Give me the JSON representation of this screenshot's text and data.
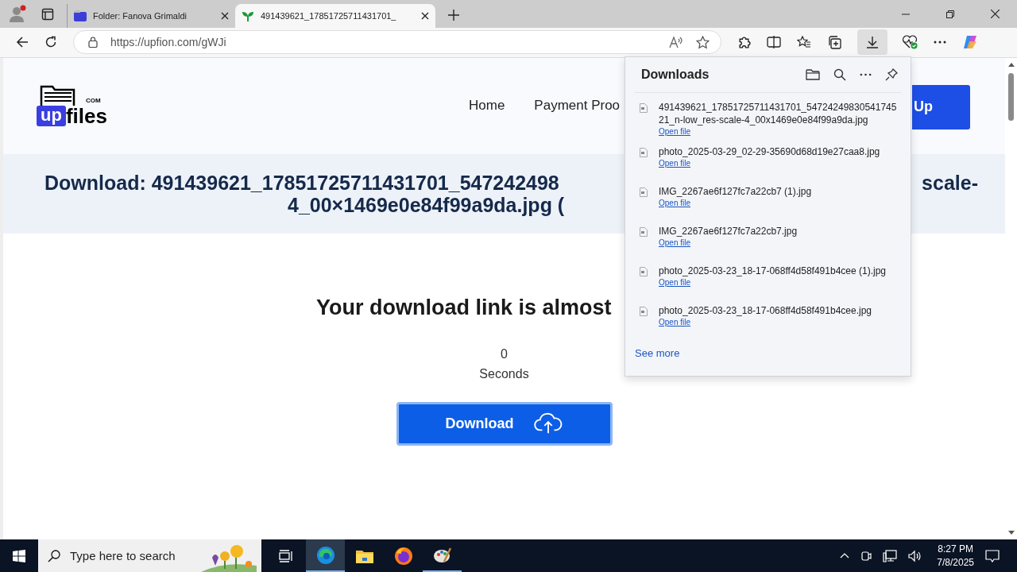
{
  "tabs": [
    {
      "title": "Folder: Fanova Grimaldi",
      "selected": false
    },
    {
      "title": "491439621_17851725711431701_",
      "selected": true
    }
  ],
  "address": "https://upfion.com/gWJi",
  "page": {
    "logo": {
      "mark": "up",
      "word": "files",
      "suffix": "COM"
    },
    "nav": [
      "Home",
      "Payment Proo"
    ],
    "nav_button": "Up",
    "heading": {
      "line1_left": "Download: 491439621_17851725711431701_547242498",
      "line1_right": "scale-",
      "line2": "4_00×1469e0e84f99a9da.jpg ("
    },
    "notice": "Your download link is almost",
    "countdown": "0",
    "countdown_unit": "Seconds",
    "download_button": "Download"
  },
  "downloads": {
    "title": "Downloads",
    "items": [
      {
        "name": "491439621_17851725711431701_5472424983054174521_n-low_res-scale-4_00x1469e0e84f99a9da.jpg",
        "action": "Open file"
      },
      {
        "name": "photo_2025-03-29_02-29-35690d68d19e27caa8.jpg",
        "action": "Open file"
      },
      {
        "name": "IMG_2267ae6f127fc7a22cb7 (1).jpg",
        "action": "Open file"
      },
      {
        "name": "IMG_2267ae6f127fc7a22cb7.jpg",
        "action": "Open file"
      },
      {
        "name": "photo_2025-03-23_18-17-068ff4d58f491b4cee (1).jpg",
        "action": "Open file"
      },
      {
        "name": "photo_2025-03-23_18-17-068ff4d58f491b4cee.jpg",
        "action": "Open file"
      }
    ],
    "see_more": "See more"
  },
  "taskbar": {
    "search_placeholder": "Type here to search",
    "time": "8:27 PM",
    "date": "7/8/2025"
  }
}
